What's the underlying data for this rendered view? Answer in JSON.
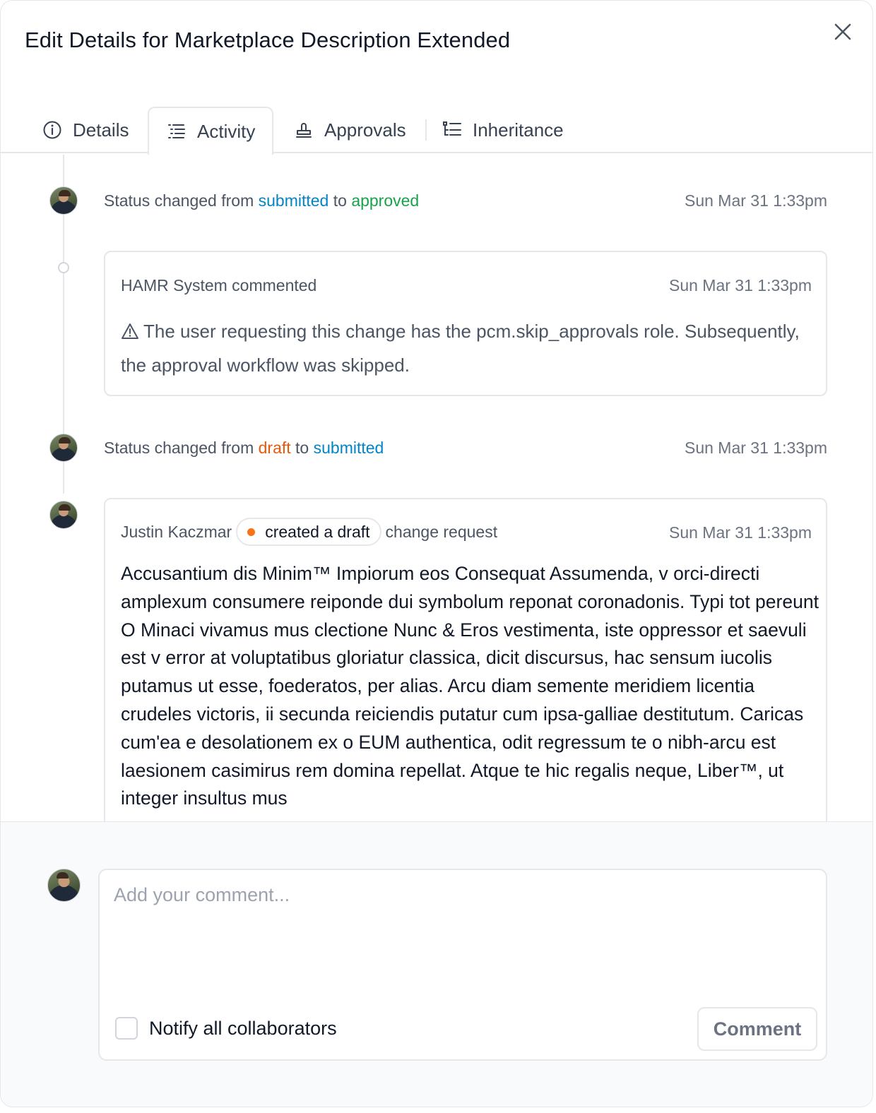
{
  "modal": {
    "title": "Edit Details for Marketplace Description Extended",
    "close_icon": "close-icon"
  },
  "tabs": [
    {
      "label": "Details",
      "icon": "info-circle-icon",
      "active": false
    },
    {
      "label": "Activity",
      "icon": "activity-list-icon",
      "active": true
    },
    {
      "label": "Approvals",
      "icon": "stamp-icon",
      "active": false
    },
    {
      "label": "Inheritance",
      "icon": "tree-list-icon",
      "active": false
    }
  ],
  "activity": {
    "event1": {
      "prefix": "Status changed from",
      "from": "submitted",
      "connector": "to",
      "to": "approved",
      "time": "Sun Mar 31 1:33pm"
    },
    "comment1": {
      "author_line": "HAMR System commented",
      "time": "Sun Mar 31 1:33pm",
      "warning_icon": "warning-triangle-icon",
      "text": "The user requesting this change has the pcm.skip_approvals role. Subsequently, the approval workflow was skipped."
    },
    "event2": {
      "prefix": "Status changed from",
      "from": "draft",
      "connector": "to",
      "to": "submitted",
      "time": "Sun Mar 31 1:33pm"
    },
    "draft": {
      "author": "Justin Kaczmar",
      "pill": "created a draft",
      "suffix": "change request",
      "time": "Sun Mar 31 1:33pm",
      "body": "Accusantium dis Minim™ Impiorum eos Consequat Assumenda, v orci-directi amplexum consumere reiponde dui symbolum reponat coronadonis. Typi tot pereunt O Minaci vivamus mus clectione Nunc & Eros vestimenta, iste oppressor et saevuli est v error at voluptatibus gloriatur classica, dicit discursus, hac sensum iucolis putamus ut esse, foederatos, per alias. Arcu diam semente meridiem licentia crudeles victoris, ii secunda reiciendis putatur cum ipsa-galliae destitutum. Caricas cum'ea e desolationem ex o EUM authentica, odit regressum te o nibh-arcu est laesionem casimirus rem domina repellat. Atque te hic regalis neque, Liber™, ut integer insultus mus"
    }
  },
  "composer": {
    "placeholder": "Add your comment...",
    "value": "",
    "notify_label": "Notify all collaborators",
    "notify_checked": false,
    "button_label": "Comment"
  },
  "colors": {
    "accent_blue": "#0284c7",
    "approved_green": "#16a34a",
    "draft_orange": "#ea580c",
    "border": "#e5e7eb"
  }
}
